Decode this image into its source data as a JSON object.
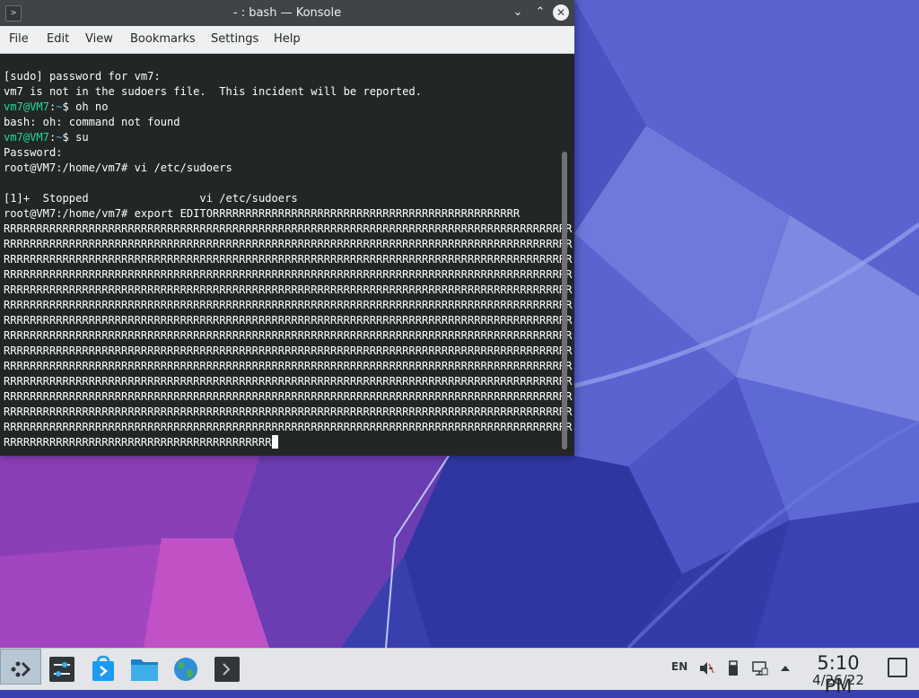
{
  "window": {
    "title": "- : bash — Konsole",
    "app_icon_glyph": ">",
    "minimize_glyph": "⌄",
    "maximize_glyph": "⌃",
    "close_glyph": "✕"
  },
  "menu": {
    "items": [
      "File",
      "Edit",
      "View",
      "Bookmarks",
      "Settings",
      "Help"
    ]
  },
  "terminal": {
    "line1": "[sudo] password for vm7:",
    "line2": "vm7 is not in the sudoers file.  This incident will be reported.",
    "prompt_user": "vm7@VM7",
    "prompt_sep": ":",
    "prompt_path": "~",
    "prompt_sym": "$ ",
    "cmd1": "oh no",
    "line4": "bash: oh: command not found",
    "cmd2": "su",
    "line6": "Password:",
    "line7": "root@VM7:/home/vm7# vi /etc/sudoers",
    "line8": "",
    "line9": "[1]+  Stopped                 vi /etc/sudoers",
    "line10": "root@VM7:/home/vm7# export EDITORRRRRRRRRRRRRRRRRRRRRRRRRRRRRRRRRRRRRRRRRRRRRRR",
    "r_line": "RRRRRRRRRRRRRRRRRRRRRRRRRRRRRRRRRRRRRRRRRRRRRRRRRRRRRRRRRRRRRRRRRRRRRRRRRRRRRRRRRRRRRRR",
    "last_line": "RRRRRRRRRRRRRRRRRRRRRRRRRRRRRRRRRRRRRRRRR"
  },
  "taskbar": {
    "language": "EN",
    "time": "5:10 PM",
    "date": "4/26/22",
    "icons": [
      "application-launcher-icon",
      "system-settings-icon",
      "discover-store-icon",
      "dolphin-file-manager-icon",
      "web-browser-icon",
      "konsole-icon"
    ],
    "tray_icons": [
      "volume-muted-icon",
      "usb-device-icon",
      "network-icon",
      "tray-expand-icon"
    ]
  },
  "colors": {
    "prompt_user": "#1cdc9a",
    "prompt_path": "#3daee9",
    "terminal_bg": "#232627",
    "terminal_fg": "#fcfcfc",
    "titlebar_bg": "#3f4448",
    "menubar_bg": "#eff0f1",
    "taskbar_bg": "#e3e5e8"
  }
}
